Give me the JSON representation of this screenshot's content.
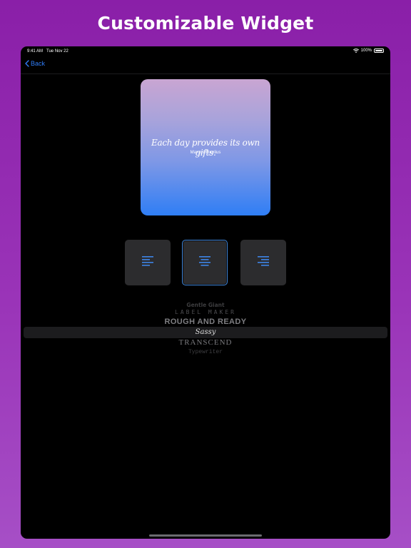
{
  "promo": {
    "title": "Customizable Widget"
  },
  "status_bar": {
    "time": "9:41 AM",
    "date": "Tue Nov 22",
    "battery": "100%",
    "battery_level": 1.0,
    "icons": [
      "wifi-icon",
      "battery-icon"
    ]
  },
  "nav": {
    "back_label": "Back",
    "back_icon": "chevron-left-icon"
  },
  "widget": {
    "quote": "Each day provides its own gifts.",
    "author": "Marcus Aurelius"
  },
  "alignment": {
    "options": [
      {
        "name": "left",
        "icon": "align-left-icon"
      },
      {
        "name": "center",
        "icon": "align-center-icon"
      },
      {
        "name": "right",
        "icon": "align-right-icon"
      }
    ],
    "selected": "center"
  },
  "font_picker": {
    "items": [
      "Gentle Giant",
      "Label Maker",
      "Rough and Ready",
      "Sassy",
      "Transcend",
      "Typewriter"
    ],
    "displayed": [
      "Gentle Giant",
      "LABEL MAKER",
      "ROUGH AND READY",
      "Sassy",
      "TRANSCEND",
      "Typewriter"
    ],
    "selected": "Sassy"
  },
  "colors": {
    "background": "#9a34b8",
    "screen": "#000000",
    "accent": "#2f7cf6",
    "tile": "#2c2c2e",
    "selected_border": "#3d84d8",
    "widget_gradient_top": "#c9a5d2",
    "widget_gradient_bottom": "#2f7ef5"
  }
}
